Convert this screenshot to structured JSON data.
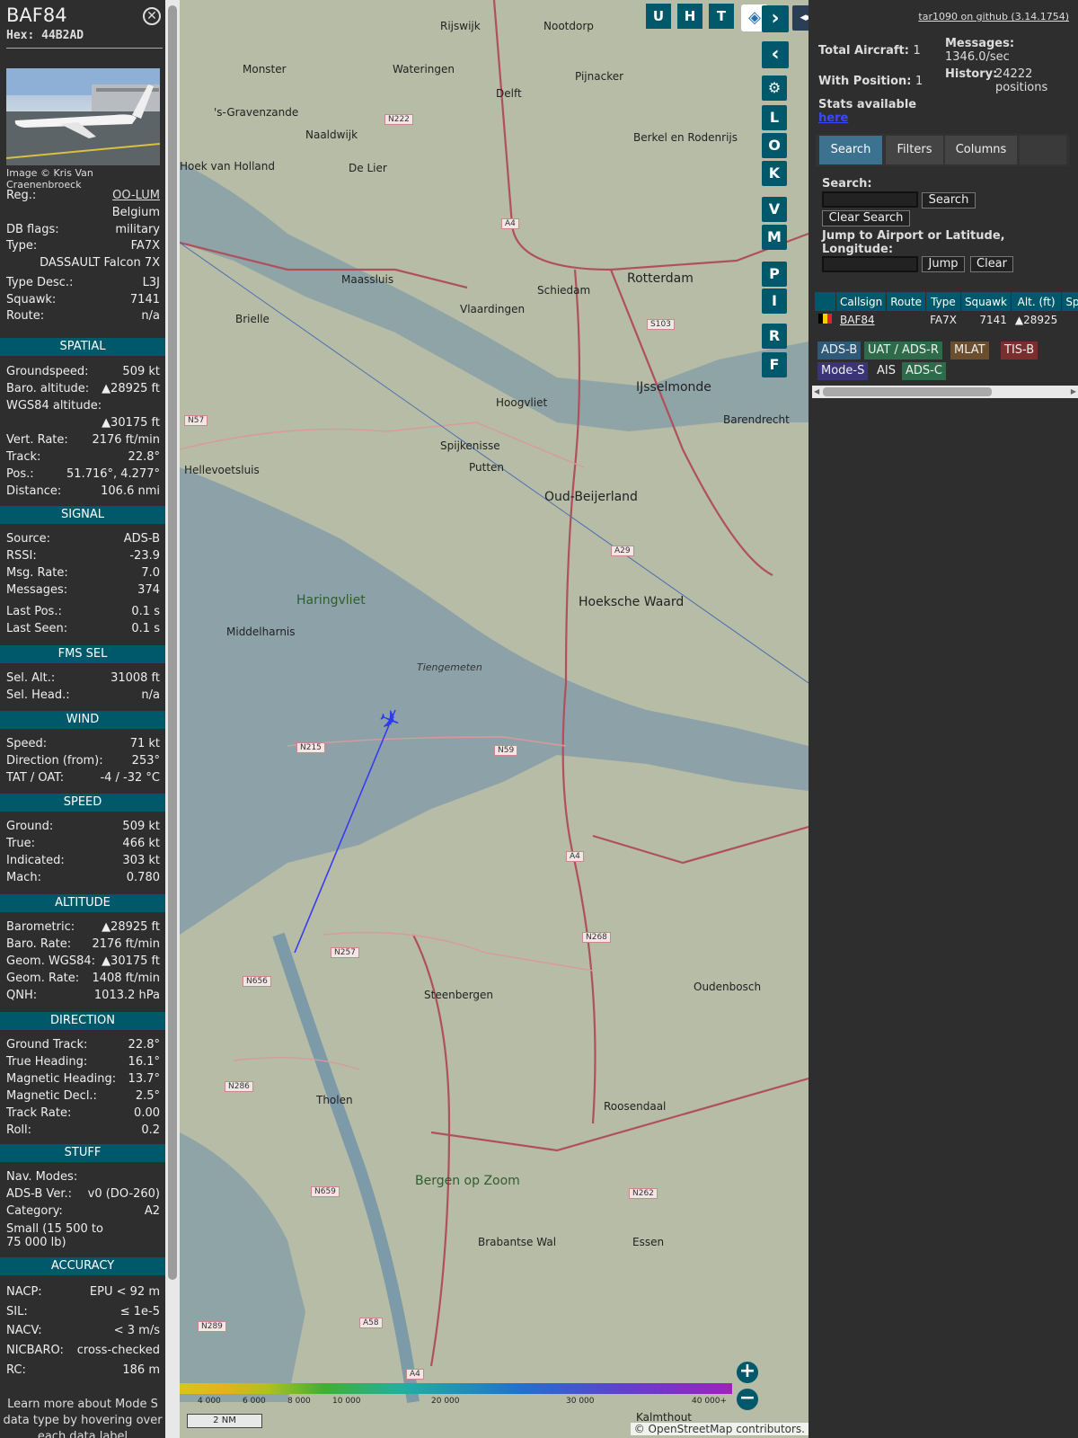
{
  "sidebar": {
    "callsign": "BAF84",
    "hex": "Hex: 44B2AD",
    "photo_credit": "Image © Kris Van Craenenbroeck",
    "info": [
      {
        "k": "Reg.:",
        "v": "OO-LUM",
        "link": true
      },
      {
        "k": "",
        "v": "Belgium"
      },
      {
        "k": "DB flags:",
        "v": "military"
      },
      {
        "k": "Type:",
        "v": "FA7X"
      },
      {
        "k": "",
        "v": "DASSAULT Falcon 7X"
      },
      {
        "k": "Type Desc.:",
        "v": "L3J"
      },
      {
        "k": "Squawk:",
        "v": "7141"
      },
      {
        "k": "Route:",
        "v": "n/a"
      }
    ],
    "sections": {
      "spatial": "SPATIAL",
      "signal": "SIGNAL",
      "fms": "FMS SEL",
      "wind": "WIND",
      "speed": "SPEED",
      "altitude": "ALTITUDE",
      "direction": "DIRECTION",
      "stuff": "STUFF",
      "accuracy": "ACCURACY"
    },
    "spatial": [
      {
        "k": "Groundspeed:",
        "v": "509 kt"
      },
      {
        "k": "Baro. altitude:",
        "v": "▲28925 ft"
      },
      {
        "k": "WGS84 altitude:",
        "v": ""
      },
      {
        "k": "",
        "v": "▲30175 ft"
      },
      {
        "k": "Vert. Rate:",
        "v": "2176 ft/min"
      },
      {
        "k": "Track:",
        "v": "22.8°"
      },
      {
        "k": "Pos.:",
        "v": "51.716°, 4.277°"
      },
      {
        "k": "Distance:",
        "v": "106.6 nmi"
      }
    ],
    "signal": [
      {
        "k": "Source:",
        "v": "ADS-B"
      },
      {
        "k": "RSSI:",
        "v": "-23.9"
      },
      {
        "k": "Msg. Rate:",
        "v": "7.0"
      },
      {
        "k": "Messages:",
        "v": "374"
      },
      {
        "k": "Last Pos.:",
        "v": "0.1 s"
      },
      {
        "k": "Last Seen:",
        "v": "0.1 s"
      }
    ],
    "fms": [
      {
        "k": "Sel. Alt.:",
        "v": "31008 ft"
      },
      {
        "k": "Sel. Head.:",
        "v": "n/a"
      }
    ],
    "wind": [
      {
        "k": "Speed:",
        "v": "71 kt"
      },
      {
        "k": "Direction (from):",
        "v": "253°"
      },
      {
        "k": "TAT / OAT:",
        "v": "-4 / -32 °C"
      }
    ],
    "speed": [
      {
        "k": "Ground:",
        "v": "509 kt"
      },
      {
        "k": "True:",
        "v": "466 kt"
      },
      {
        "k": "Indicated:",
        "v": "303 kt"
      },
      {
        "k": "Mach:",
        "v": "0.780"
      }
    ],
    "altitude": [
      {
        "k": "Barometric:",
        "v": "▲28925 ft"
      },
      {
        "k": "Baro. Rate:",
        "v": "2176 ft/min"
      },
      {
        "k": "Geom. WGS84:",
        "v": "▲30175 ft"
      },
      {
        "k": "Geom. Rate:",
        "v": "1408 ft/min"
      },
      {
        "k": "QNH:",
        "v": "1013.2 hPa"
      }
    ],
    "direction": [
      {
        "k": "Ground Track:",
        "v": "22.8°"
      },
      {
        "k": "True Heading:",
        "v": "16.1°"
      },
      {
        "k": "Magnetic Heading:",
        "v": "13.7°"
      },
      {
        "k": "Magnetic Decl.:",
        "v": "2.5°"
      },
      {
        "k": "Track Rate:",
        "v": "0.00"
      },
      {
        "k": "Roll:",
        "v": "0.2"
      }
    ],
    "stuff": [
      {
        "k": "Nav. Modes:",
        "v": ""
      },
      {
        "k": "ADS-B Ver.:",
        "v": "v0 (DO-260)"
      },
      {
        "k": "Category:",
        "v": "A2"
      },
      {
        "k": "Small (15 500 to",
        "v": ""
      },
      {
        "k": "75 000 lb)",
        "v": ""
      }
    ],
    "accuracy": [
      {
        "k": "NACP:",
        "v": "EPU < 92 m"
      },
      {
        "k": "SIL:",
        "v": "≤ 1e-5"
      },
      {
        "k": "NACV:",
        "v": "< 3 m/s"
      },
      {
        "k": "NICBARO:",
        "v": "cross-checked"
      },
      {
        "k": "RC:",
        "v": "186 m"
      }
    ],
    "footer": "Learn more about Mode S data type by hovering over each data label"
  },
  "map": {
    "top_buttons": [
      "U",
      "H",
      "T"
    ],
    "side_buttons": [
      "L",
      "O",
      "K",
      "V",
      "M",
      "P",
      "I",
      "R",
      "F"
    ],
    "scale": "2 NM",
    "attribution": "© OpenStreetMap contributors.",
    "altitude_ticks": [
      "4 000",
      "6 000",
      "8 000",
      "10 000",
      "20 000",
      "30 000",
      "40 000+"
    ],
    "places": [
      "Rijswijk",
      "Nootdorp",
      "Monster",
      "Wateringen",
      "Pijnacker",
      "Delft",
      "'s-Gravenzande",
      "Naaldwijk",
      "Berkel en Rodenrijs",
      "Hoek van Holland",
      "De Lier",
      "Rotterdam",
      "Maassluis",
      "Schiedam",
      "Vlaardingen",
      "Brielle",
      "IJsselmonde",
      "Hoogvliet",
      "Barendrecht",
      "Hellevoetsluis",
      "Spijkenisse",
      "Putten",
      "Oud-Beijerland",
      "Haringvliet",
      "Hoeksche Waard",
      "Middelharnis",
      "Tiengemeten",
      "Steenbergen",
      "Oudenbosch",
      "Tholen",
      "Roosendaal",
      "Bergen op Zoom",
      "Essen",
      "Brabantse Wal",
      "Kalmthout"
    ]
  },
  "right": {
    "github": "tar1090 on github (3.14.1754)",
    "total_aircraft_label": "Total Aircraft:",
    "total_aircraft": "1",
    "with_position_label": "With Position:",
    "with_position": "1",
    "stats_label": "Stats available",
    "stats_link": "here",
    "messages_label": "Messages:",
    "messages_value": "1346.0/sec",
    "history_label": "History:",
    "history_value": "24222 positions",
    "tabs": [
      "Search",
      "Filters",
      "Columns"
    ],
    "search_label": "Search:",
    "search_button": "Search",
    "clear_search": "Clear Search",
    "jump_label": "Jump to Airport or Latitude, Longitude:",
    "jump_button": "Jump",
    "clear_button": "Clear",
    "table_headers": [
      "",
      "Callsign",
      "Route",
      "Type",
      "Squawk",
      "Alt. (ft)",
      "Spd"
    ],
    "table_rows": [
      [
        "",
        "BAF84",
        "",
        "FA7X",
        "7141",
        "▲28925",
        ""
      ]
    ],
    "legend": [
      {
        "label": "ADS-B",
        "color": "#2d5a78"
      },
      {
        "label": "UAT / ADS-R",
        "color": "#2e6b4a"
      },
      {
        "label": "MLAT",
        "color": "#6b4e2e"
      },
      {
        "label": "TIS-B",
        "color": "#7a2e2e"
      },
      {
        "label": "Mode-S",
        "color": "#3b3577"
      },
      {
        "label": "AIS",
        "color": "#2e2e2e"
      },
      {
        "label": "ADS-C",
        "color": "#2e6b4a"
      }
    ]
  }
}
